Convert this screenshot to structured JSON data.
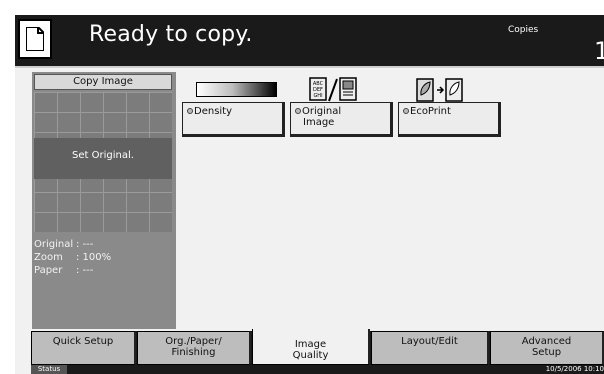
{
  "header": {
    "status_title": "Ready to copy.",
    "copies_label": "Copies",
    "copies_value": "1"
  },
  "preview": {
    "title": "Copy Image",
    "message": "Set Original.",
    "info": [
      {
        "label": "Original",
        "value": ": ---"
      },
      {
        "label": "Zoom",
        "value": ": 100%"
      },
      {
        "label": "Paper",
        "value": ": ---"
      }
    ]
  },
  "functions": {
    "density": "Density",
    "original_image_line1": "Original",
    "original_image_line2": "Image",
    "ecoprint": "EcoPrint"
  },
  "tabs": [
    {
      "line1": "Quick Setup",
      "line2": ""
    },
    {
      "line1": "Org./Paper/",
      "line2": "Finishing"
    },
    {
      "line1": "Image",
      "line2": "Quality"
    },
    {
      "line1": "Layout/Edit",
      "line2": ""
    },
    {
      "line1": "Advanced",
      "line2": "Setup"
    }
  ],
  "statusbar": {
    "status_label": "Status",
    "datetime": "10/5/2006   10:10"
  },
  "colors": {
    "header_bg": "#1a1a1a",
    "panel_bg": "#8a8a8a",
    "tab_bg": "#bdbdbd",
    "active_tab_bg": "#f1f1f1"
  }
}
